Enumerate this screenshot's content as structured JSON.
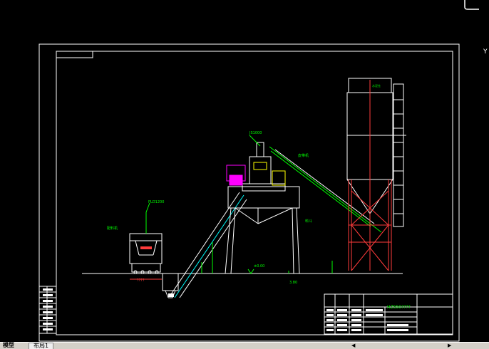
{
  "drawing": {
    "labels": {
      "mixer_top": "JS1000",
      "conveyor": "皮带机",
      "silo_label": "水泥仓",
      "batcher": "PLD1200",
      "batcher_side": "配料机",
      "titlebox_code": "HZS50????",
      "dim_bottom": "????",
      "elev1": "±0.00",
      "elev2": "3.80",
      "side_label": "料斗"
    }
  },
  "ui": {
    "tab_model": "模型",
    "tab_layout": "布局1",
    "scroll_left": "◀",
    "scroll_right": "▶",
    "side_marker": "Y"
  },
  "colors": {
    "frame": "#ffffff",
    "structure": "#ffffff",
    "silo_legs": "#ff3b3b",
    "mixer": "#ff00ff",
    "green": "#00ff00",
    "cyan": "#00ffff",
    "yellow": "#ffff00"
  }
}
